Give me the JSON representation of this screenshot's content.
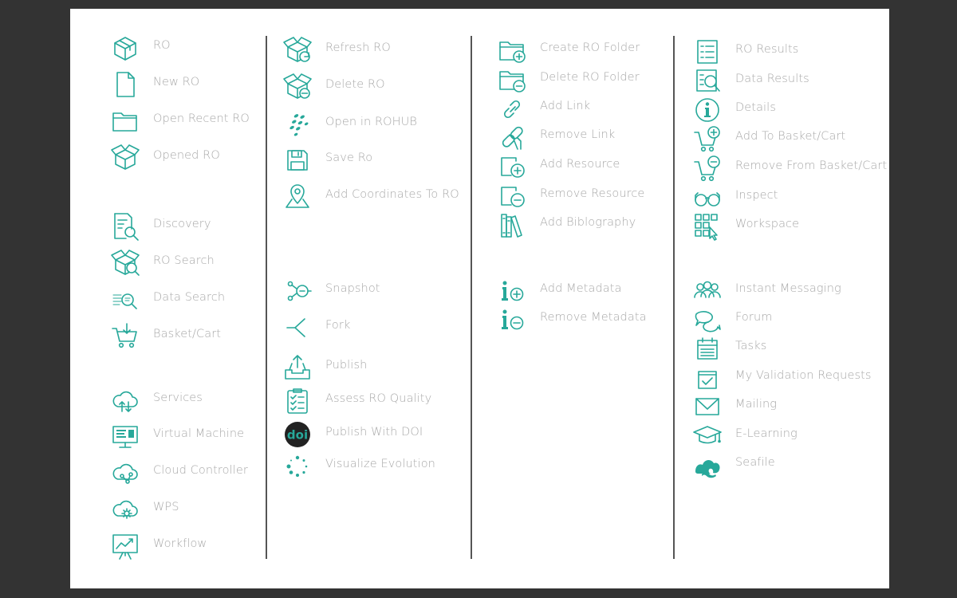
{
  "accent_color": "#27a89a",
  "columns": [
    {
      "items": [
        {
          "label": "RO",
          "icon": "box-icon"
        },
        {
          "label": "New RO",
          "icon": "new-file-icon"
        },
        {
          "label": "Open Recent RO",
          "icon": "folder-icon"
        },
        {
          "label": "Opened RO",
          "icon": "open-box-icon"
        },
        {
          "label": "Discovery",
          "icon": "document-search-icon"
        },
        {
          "label": "RO Search",
          "icon": "box-search-icon"
        },
        {
          "label": "Data Search",
          "icon": "data-search-icon"
        },
        {
          "label": "Basket/Cart",
          "icon": "cart-download-icon"
        },
        {
          "label": "Services",
          "icon": "cloud-transfer-icon"
        },
        {
          "label": "Virtual Machine",
          "icon": "monitor-icon"
        },
        {
          "label": "Cloud Controller",
          "icon": "cloud-network-icon"
        },
        {
          "label": "WPS",
          "icon": "cloud-gear-icon"
        },
        {
          "label": "Workflow",
          "icon": "presentation-chart-icon"
        }
      ]
    },
    {
      "items": [
        {
          "label": "Refresh RO",
          "icon": "box-refresh-icon"
        },
        {
          "label": "Delete RO",
          "icon": "box-delete-icon"
        },
        {
          "label": "Open in ROHUB",
          "icon": "rohub-logo-icon"
        },
        {
          "label": "Save Ro",
          "icon": "save-icon"
        },
        {
          "label": "Add Coordinates To RO",
          "icon": "map-pin-icon"
        },
        {
          "label": "Snapshot",
          "icon": "snapshot-icon"
        },
        {
          "label": "Fork",
          "icon": "fork-icon"
        },
        {
          "label": "Publish",
          "icon": "tray-upload-icon"
        },
        {
          "label": "Assess RO Quality",
          "icon": "clipboard-check-icon"
        },
        {
          "label": "Publish With DOI",
          "icon": "doi-logo-icon",
          "logo_text": "doi"
        },
        {
          "label": "Visualize Evolution",
          "icon": "dotted-circle-icon"
        }
      ]
    },
    {
      "items": [
        {
          "label": "Create RO Folder",
          "icon": "folder-add-icon"
        },
        {
          "label": "Delete RO Folder",
          "icon": "folder-remove-icon"
        },
        {
          "label": "Add Link",
          "icon": "link-icon"
        },
        {
          "label": "Remove Link",
          "icon": "broken-link-icon"
        },
        {
          "label": "Add Resource",
          "icon": "resource-add-icon"
        },
        {
          "label": "Remove Resource",
          "icon": "resource-remove-icon"
        },
        {
          "label": "Add Biblography",
          "icon": "books-icon"
        },
        {
          "label": "Add Metadata",
          "icon": "info-add-icon"
        },
        {
          "label": "Remove Metadata",
          "icon": "info-remove-icon"
        }
      ]
    },
    {
      "items": [
        {
          "label": "RO Results",
          "icon": "list-icon"
        },
        {
          "label": "Data Results",
          "icon": "list-search-icon"
        },
        {
          "label": "Details",
          "icon": "info-circle-icon"
        },
        {
          "label": "Add To Basket/Cart",
          "icon": "cart-add-icon"
        },
        {
          "label": "Remove From Basket/Cart",
          "icon": "cart-remove-icon"
        },
        {
          "label": "Inspect",
          "icon": "glasses-icon"
        },
        {
          "label": "Workspace",
          "icon": "grid-pointer-icon"
        },
        {
          "label": "Instant Messaging",
          "icon": "people-icon"
        },
        {
          "label": "Forum",
          "icon": "chat-bubbles-icon"
        },
        {
          "label": "Tasks",
          "icon": "calendar-icon"
        },
        {
          "label": "My Validation Requests",
          "icon": "checkbox-icon"
        },
        {
          "label": "Mailing",
          "icon": "envelope-icon"
        },
        {
          "label": "E-Learning",
          "icon": "graduation-cap-icon"
        },
        {
          "label": "Seafile",
          "icon": "seafile-logo-icon"
        }
      ]
    }
  ]
}
